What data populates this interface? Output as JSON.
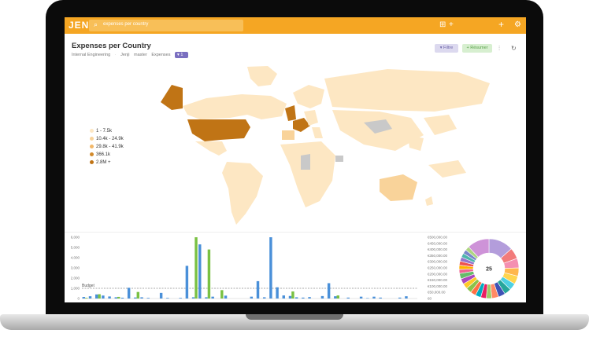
{
  "app": {
    "logo": "JENJI",
    "search": "expenses per country"
  },
  "page": {
    "title": "Expenses per Country",
    "breadcrumbs": [
      "Internal Engineering",
      "Jenji",
      "master",
      "Expenses"
    ],
    "filter_count": "1",
    "buttons": {
      "filter": "Filtre",
      "summary": "Résumer"
    }
  },
  "map_legend": [
    {
      "label": "1 - 7.5k",
      "color": "#fde7c3"
    },
    {
      "label": "10.4k - 24.9k",
      "color": "#f9d39a"
    },
    {
      "label": "29.8k - 41.9k",
      "color": "#f2b86a"
    },
    {
      "label": "366.1k",
      "color": "#d28a2c"
    },
    {
      "label": "2.8M +",
      "color": "#c07415"
    }
  ],
  "bar_chart": {
    "budget_label": "Budget",
    "budget_value": 1000,
    "ymax": 6000,
    "left_ticks": [
      "6,000",
      "5,000",
      "4,000",
      "3,000",
      "2,000",
      "1,000",
      "0"
    ],
    "right_ticks": [
      "€500,000.00",
      "€450,000.00",
      "€400,000.00",
      "€350,000.00",
      "€300,000.00",
      "€250,000.00",
      "€200,000.00",
      "€150,000.00",
      "€100,000.00",
      "€50,000.00",
      "€0"
    ],
    "colors": {
      "blue": "#4a90d9",
      "green": "#7ac143"
    },
    "blue": [
      150,
      220,
      400,
      290,
      200,
      120,
      80,
      1050,
      100,
      120,
      60,
      0,
      550,
      60,
      0,
      60,
      3200,
      120,
      5300,
      120,
      180,
      0,
      280,
      0,
      0,
      0,
      180,
      1700,
      120,
      6000,
      1100,
      300,
      250,
      120,
      90,
      140,
      0,
      240,
      1500,
      220,
      0,
      90,
      0,
      180,
      40,
      180,
      90,
      0,
      0,
      90,
      220,
      0
    ],
    "green": [
      60,
      0,
      420,
      0,
      0,
      160,
      0,
      0,
      640,
      0,
      0,
      0,
      0,
      0,
      0,
      0,
      0,
      6000,
      0,
      4800,
      0,
      820,
      0,
      0,
      0,
      0,
      0,
      0,
      0,
      0,
      0,
      0,
      690,
      0,
      0,
      0,
      0,
      0,
      0,
      300,
      0,
      0,
      0,
      0,
      0,
      0,
      0,
      0,
      0,
      0,
      0,
      0
    ]
  },
  "donut": {
    "total": "25",
    "segments": [
      {
        "value": 18,
        "color": "#b39ddb"
      },
      {
        "value": 8,
        "color": "#f27b7b"
      },
      {
        "value": 7,
        "color": "#f48fb1"
      },
      {
        "value": 6,
        "color": "#ffb74d"
      },
      {
        "value": 6,
        "color": "#ffd54f"
      },
      {
        "value": 5,
        "color": "#4dd0e1"
      },
      {
        "value": 5,
        "color": "#26a69a"
      },
      {
        "value": 5,
        "color": "#3f51b5"
      },
      {
        "value": 5,
        "color": "#ff8a65"
      },
      {
        "value": 4,
        "color": "#9ccc65"
      },
      {
        "value": 4,
        "color": "#e91e63"
      },
      {
        "value": 4,
        "color": "#00acc1"
      },
      {
        "value": 4,
        "color": "#ff7043"
      },
      {
        "value": 4,
        "color": "#8bc34a"
      },
      {
        "value": 4,
        "color": "#ffca28"
      },
      {
        "value": 4,
        "color": "#ab47bc"
      },
      {
        "value": 4,
        "color": "#66bb6a"
      },
      {
        "value": 3,
        "color": "#f06292"
      },
      {
        "value": 3,
        "color": "#ffb300"
      },
      {
        "value": 3,
        "color": "#ef5350"
      },
      {
        "value": 3,
        "color": "#9575cd"
      },
      {
        "value": 3,
        "color": "#4db6ac"
      },
      {
        "value": 3,
        "color": "#7986cb"
      },
      {
        "value": 3,
        "color": "#aed581"
      },
      {
        "value": 16,
        "color": "#ce93d8"
      }
    ]
  }
}
